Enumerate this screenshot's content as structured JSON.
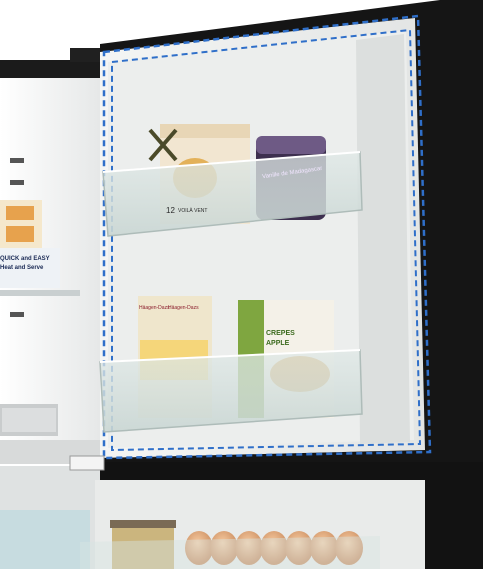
{
  "scene": {
    "subject": "refrigerator-with-open-upper-door",
    "highlight_color": "#2f6fc9",
    "door_color": "#141414",
    "interior_color": "#ecedec"
  },
  "labels": {
    "box_top_left": "12",
    "box_top_left_line": "VOILÀ VENT",
    "jar_label": "Vanille de Madagascar",
    "icecream_brand_1": "Häagen-Dazs",
    "icecream_brand_2": "Häagen-Dazs",
    "pastry_brand": "CREPES",
    "pastry_name": "APPLE",
    "fridge_box_line1": "QUICK and EASY",
    "fridge_box_line2": "Heat and Serve"
  }
}
